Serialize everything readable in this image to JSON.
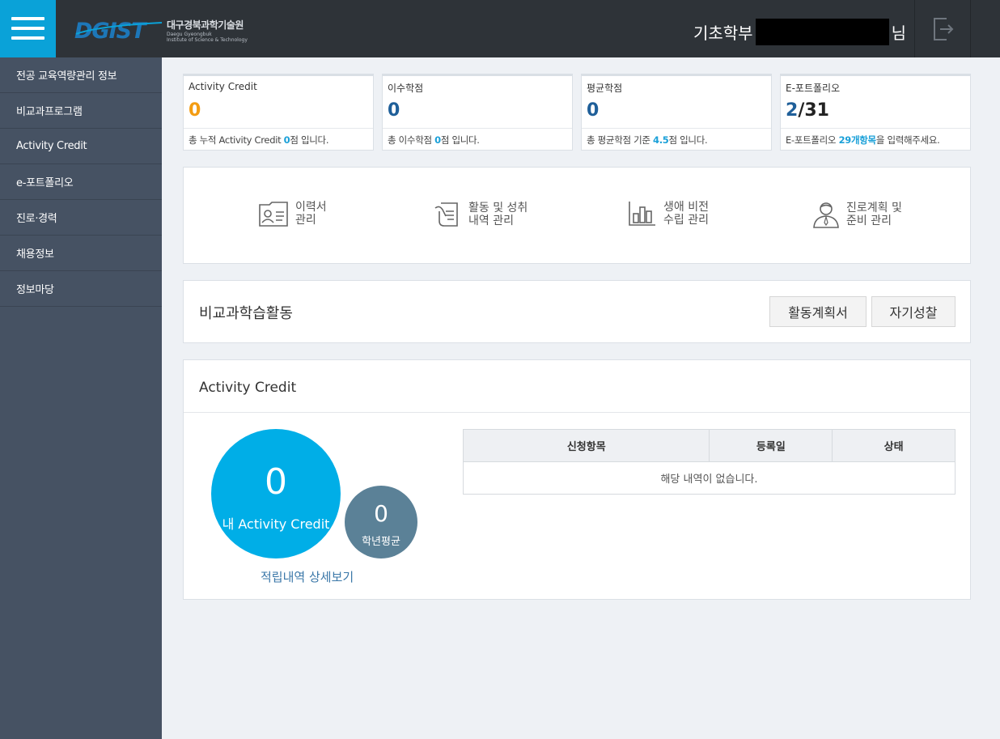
{
  "header": {
    "logo_ko": "대구경북과학기술원",
    "logo_en": "Daegu Gyeongbuk\nInstitute of Science & Technology",
    "user_dept": "기초학부",
    "user_suffix": "님"
  },
  "sidebar": {
    "items": [
      {
        "label": "전공 교육역량관리 정보"
      },
      {
        "label": "비교과프로그램"
      },
      {
        "label": "Activity Credit"
      },
      {
        "label": "e-포트폴리오"
      },
      {
        "label": "진로·경력"
      },
      {
        "label": "채용정보"
      },
      {
        "label": "정보마당"
      }
    ]
  },
  "stats": [
    {
      "title": "Activity Credit",
      "value": "0",
      "color": "#f39c12",
      "note_pre": "총 누적 Activity Credit ",
      "note_em": "0",
      "note_post": "점 입니다."
    },
    {
      "title": "이수학점",
      "value": "0",
      "color": "#1f5f99",
      "note_pre": "총 이수학점 ",
      "note_em": "0",
      "note_post": "점 입니다."
    },
    {
      "title": "평균학점",
      "value": "0",
      "color": "#1f5f99",
      "note_pre": "총 평균학점 기준 ",
      "note_em": "4.5",
      "note_post": "점 입니다."
    },
    {
      "title": "E-포트폴리오",
      "value_a": "2",
      "value_b": "/31",
      "color": "#1f5f99",
      "note_pre": "E-포트폴리오 ",
      "note_em": "29개항목",
      "note_post": "을 입력해주세요."
    }
  ],
  "shortcuts": [
    {
      "label": "이력서\n관리",
      "icon": "id-card-icon"
    },
    {
      "label": "활동 및 성취\n내역 관리",
      "icon": "hand-document-icon"
    },
    {
      "label": "생애 비전\n수립 관리",
      "icon": "bar-chart-icon"
    },
    {
      "label": "진로계획 및\n준비 관리",
      "icon": "person-icon"
    }
  ],
  "compare": {
    "title": "비교과학습활동",
    "plan_button": "활동계획서",
    "reflect_button": "자기성찰"
  },
  "credit": {
    "title": "Activity Credit",
    "my_value": "0",
    "my_label": "내 Activity Credit",
    "avg_value": "0",
    "avg_label": "학년평균",
    "detail_link": "적립내역 상세보기",
    "table": {
      "headers": [
        "신청항목",
        "등록일",
        "상태"
      ],
      "empty_text": "해당 내역이 없습니다."
    }
  },
  "colors": {
    "accent": "#0aa2d8",
    "highlight": "#1aa0d8",
    "header_bg": "#2e3338",
    "sidebar_bg": "#465263"
  }
}
